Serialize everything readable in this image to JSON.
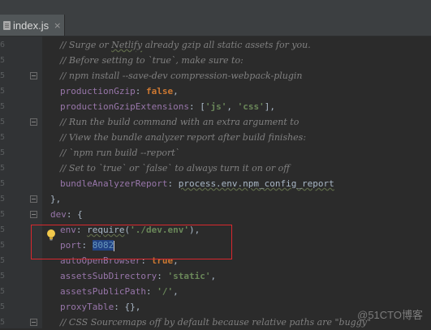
{
  "tab": {
    "label": "index.js"
  },
  "lines": [
    {
      "segments": [
        {
          "cls": "comment",
          "text": "// Surge or "
        },
        {
          "cls": "comment squig",
          "text": "Netlify"
        },
        {
          "cls": "comment",
          "text": " already gzip all static assets for you."
        }
      ]
    },
    {
      "segments": [
        {
          "cls": "comment",
          "text": "// Before setting to `true`, make sure to:"
        }
      ]
    },
    {
      "segments": [
        {
          "cls": "comment",
          "text": "// npm install --save-dev compression-webpack-plugin"
        }
      ]
    },
    {
      "segments": [
        {
          "cls": "prop",
          "text": "productionGzip"
        },
        {
          "cls": "plain",
          "text": ": "
        },
        {
          "cls": "kw",
          "text": "false"
        },
        {
          "cls": "plain",
          "text": ","
        }
      ]
    },
    {
      "segments": [
        {
          "cls": "prop",
          "text": "productionGzipExtensions"
        },
        {
          "cls": "plain",
          "text": ": ["
        },
        {
          "cls": "str",
          "text": "'js'"
        },
        {
          "cls": "plain",
          "text": ", "
        },
        {
          "cls": "str",
          "text": "'css'"
        },
        {
          "cls": "plain",
          "text": "],"
        }
      ]
    },
    {
      "segments": [
        {
          "cls": "comment",
          "text": "// Run the build command with an extra argument to"
        }
      ]
    },
    {
      "segments": [
        {
          "cls": "comment",
          "text": "// View the bundle analyzer report after build finishes:"
        }
      ]
    },
    {
      "segments": [
        {
          "cls": "comment",
          "text": "// `npm run build --report`"
        }
      ]
    },
    {
      "segments": [
        {
          "cls": "comment",
          "text": "// Set to `true` or `false` to always turn it on or off"
        }
      ]
    },
    {
      "segments": [
        {
          "cls": "prop",
          "text": "bundleAnalyzerReport"
        },
        {
          "cls": "plain",
          "text": ": "
        },
        {
          "cls": "plain squig",
          "text": "process.env.npm_config_report"
        }
      ]
    },
    {
      "segments": [
        {
          "cls": "plain",
          "text": "},"
        }
      ]
    },
    {
      "segments": [
        {
          "cls": "prop",
          "text": "dev"
        },
        {
          "cls": "plain",
          "text": ": {"
        }
      ]
    },
    {
      "segments": [
        {
          "cls": "prop",
          "text": "env"
        },
        {
          "cls": "plain",
          "text": ": "
        },
        {
          "cls": "plain squig",
          "text": "require"
        },
        {
          "cls": "plain",
          "text": "("
        },
        {
          "cls": "str",
          "text": "'./dev.env'"
        },
        {
          "cls": "plain",
          "text": "),"
        }
      ]
    },
    {
      "segments": [
        {
          "cls": "prop",
          "text": "port"
        },
        {
          "cls": "plain",
          "text": ": "
        },
        {
          "cls": "num caret-sel",
          "text": "8082"
        }
      ]
    },
    {
      "segments": [
        {
          "cls": "prop",
          "text": "autoOpenBrowser"
        },
        {
          "cls": "plain",
          "text": ": "
        },
        {
          "cls": "kw",
          "text": "true"
        },
        {
          "cls": "plain",
          "text": ","
        }
      ]
    },
    {
      "segments": [
        {
          "cls": "prop",
          "text": "assetsSubDirectory"
        },
        {
          "cls": "plain",
          "text": ": "
        },
        {
          "cls": "str",
          "text": "'static'"
        },
        {
          "cls": "plain",
          "text": ","
        }
      ]
    },
    {
      "segments": [
        {
          "cls": "prop",
          "text": "assetsPublicPath"
        },
        {
          "cls": "plain",
          "text": ": "
        },
        {
          "cls": "str",
          "text": "'/'"
        },
        {
          "cls": "plain",
          "text": ","
        }
      ]
    },
    {
      "segments": [
        {
          "cls": "prop",
          "text": "proxyTable"
        },
        {
          "cls": "plain",
          "text": ": {},"
        }
      ]
    },
    {
      "segments": [
        {
          "cls": "comment",
          "text": "// CSS Sourcemaps off by default because relative paths are \"buggy\""
        }
      ]
    }
  ],
  "gutter_digits": [
    "6",
    "5",
    "5",
    "5",
    "5",
    "5",
    "5",
    "5",
    "5",
    "5",
    "5",
    "5",
    "5",
    "5",
    "5",
    "5",
    "5",
    "5",
    "5"
  ],
  "watermark": "@51CTO博客",
  "colors": {
    "highlight_box": "#d9282e",
    "background": "#2b2b2b",
    "gutter": "#313335"
  }
}
